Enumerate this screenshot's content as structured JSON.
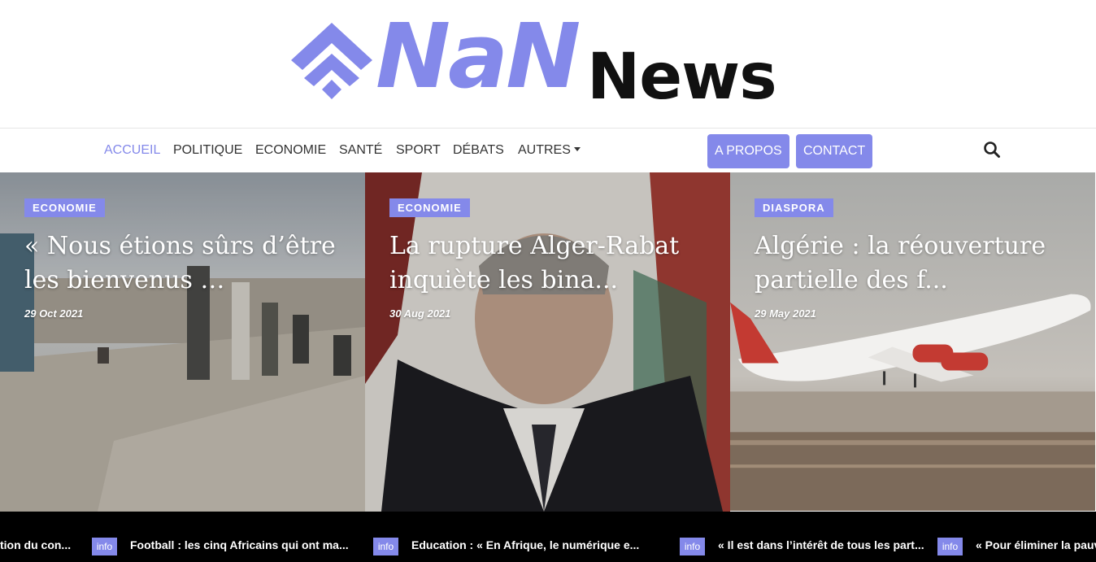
{
  "brand": {
    "logo_nan": "NaN",
    "logo_news": "News",
    "accent": "#8489ea"
  },
  "nav": {
    "items": [
      "ACCUEIL",
      "POLITIQUE",
      "ECONOMIE",
      "SANTÉ",
      "SPORT",
      "DÉBATS",
      "AUTRES"
    ],
    "active": "ACCUEIL",
    "buttons": [
      "A PROPOS",
      "CONTACT"
    ],
    "search_icon": "search-icon"
  },
  "cards": [
    {
      "tag": "ECONOMIE",
      "title": "« Nous étions sûrs d’être les bienvenus …",
      "date": "29 Oct 2021"
    },
    {
      "tag": "ECONOMIE",
      "title": "La rupture Alger-Rabat inquiète les bina...",
      "date": "30 Aug 2021"
    },
    {
      "tag": "DIASPORA",
      "title": "Algérie : la réouverture partielle des f...",
      "date": "29 May 2021"
    }
  ],
  "ticker": {
    "badge": "info",
    "items": [
      "tion du con...",
      "Football : les cinq Africains qui ont ma...",
      "Education : « En Afrique, le numérique e...",
      "« Il est dans l’intérêt de tous les part...",
      "« Pour éliminer la pauv"
    ]
  }
}
